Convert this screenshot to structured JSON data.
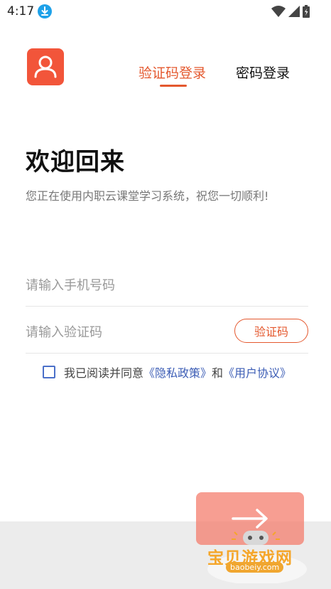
{
  "status_bar": {
    "time": "4:17"
  },
  "tabs": {
    "sms_login": "验证码登录",
    "password_login": "密码登录"
  },
  "headline": "欢迎回来",
  "subtitle": "您正在使用内职云课堂学习系统，祝您一切顺利!",
  "form": {
    "phone_placeholder": "请输入手机号码",
    "code_placeholder": "请输入验证码",
    "get_code_label": "验证码"
  },
  "agreement": {
    "prefix": "我已阅读并同意",
    "privacy_link": "《隐私政策》",
    "connector": "和",
    "terms_link": "《用户协议》"
  },
  "watermark": {
    "text": "宝贝游戏网",
    "url": "baobeiy.com"
  },
  "colors": {
    "accent": "#e4582e",
    "link": "#3b5cb5",
    "submit": "#f47868"
  },
  "icons": {
    "download": "download-icon",
    "wifi": "wifi-icon",
    "signal": "signal-icon",
    "battery": "battery-icon",
    "logo": "user-icon",
    "submit": "arrow-right-icon"
  }
}
